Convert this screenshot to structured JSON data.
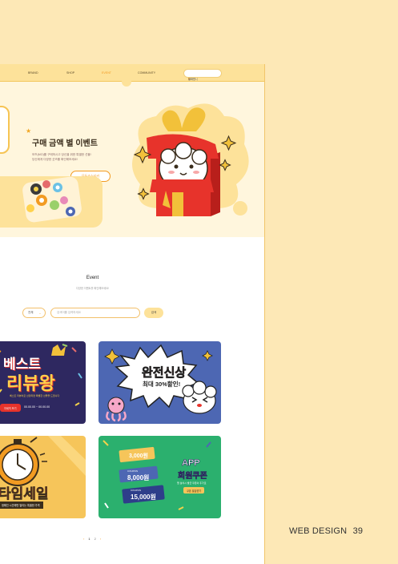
{
  "nav": {
    "items": [
      "BRAND",
      "SHOP",
      "EVENT",
      "COMMUNITY"
    ],
    "util_login": "로그인",
    "util_cart": "장바구니"
  },
  "hero": {
    "title": "구매 금액 별 이벤트",
    "text": "모츠(MO)를 구매하시고 당신을 위한 특별한 선물!\n당신에게 다양한 굿즈를 확인해보세요!",
    "button": "모두즈스티커"
  },
  "event": {
    "title": "Event",
    "subtitle": "다양한 이벤트를 확인해보세요!"
  },
  "filter": {
    "selected": "전체"
  },
  "search": {
    "placeholder": "검색어를 입력하세요",
    "button": "검색"
  },
  "cards": {
    "review_title": "베스트",
    "review_big": "리뷰왕",
    "review_small": "베스트 리뷰어로 선정되면 특별한 선물을 드립니다",
    "review_date": "00.00.00 ~ 00.00.00",
    "review_btn": "자세히 보기",
    "new_line1": "완전신상",
    "new_line2": "최대 30%할인!",
    "time_title": "타임세일",
    "time_small": "정해진 시간에만 열리는 특별한 가격",
    "coupon_amounts": [
      "3,000원",
      "8,000원",
      "15,000원"
    ],
    "coupon_label": "COUPON",
    "app_title_1": "APP",
    "app_title_2": "회원쿠폰",
    "app_small": "앱 설치시 발급 쿠폰이 추가로",
    "app_btn": "쿠폰 발급받기"
  },
  "pager": {
    "prev": "‹",
    "pages": [
      "1",
      "2"
    ],
    "next": "›"
  },
  "footer": {
    "label": "WEB DESIGN",
    "page": "39"
  },
  "colors": {
    "background": "#fde8b6",
    "accent": "#f29b22",
    "yellow": "#fde29a",
    "navy": "#2e2860",
    "blue": "#4d67b3",
    "green": "#2bb06e"
  }
}
